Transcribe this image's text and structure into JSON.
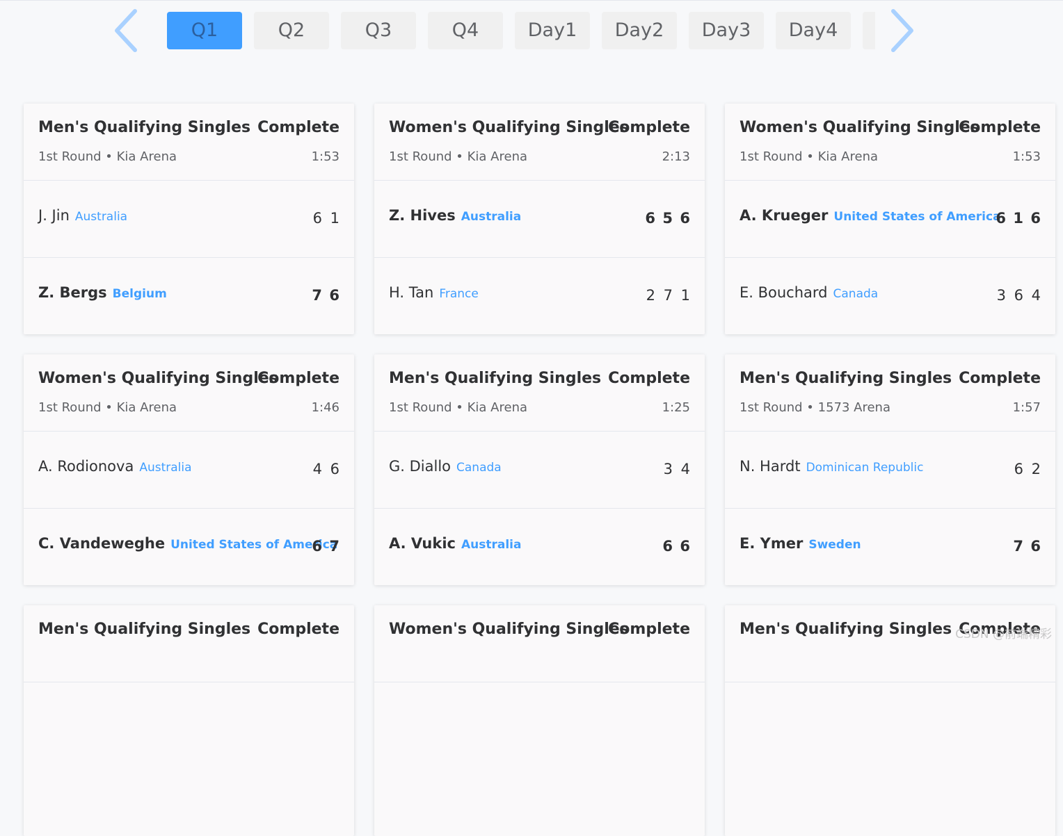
{
  "tabs": [
    "Q1",
    "Q2",
    "Q3",
    "Q4",
    "Day1",
    "Day2",
    "Day3",
    "Day4",
    ""
  ],
  "active_tab": 0,
  "colors": {
    "accent": "#409eff",
    "arrow": "#a9d1ff"
  },
  "matches": [
    {
      "event": "Men's Qualifying Singles",
      "status": "Complete",
      "round": "1st Round • Kia Arena",
      "duration": "1:53",
      "players": [
        {
          "name": "J. Jin",
          "country": "Australia",
          "scores": [
            "6",
            "1"
          ],
          "winner": false
        },
        {
          "name": "Z. Bergs",
          "country": "Belgium",
          "scores": [
            "7",
            "6"
          ],
          "winner": true
        }
      ]
    },
    {
      "event": "Women's Qualifying Singles",
      "status": "Complete",
      "round": "1st Round • Kia Arena",
      "duration": "2:13",
      "players": [
        {
          "name": "Z. Hives",
          "country": "Australia",
          "scores": [
            "6",
            "5",
            "6"
          ],
          "winner": true
        },
        {
          "name": "H. Tan",
          "country": "France",
          "scores": [
            "2",
            "7",
            "1"
          ],
          "winner": false
        }
      ]
    },
    {
      "event": "Women's Qualifying Singles",
      "status": "Complete",
      "round": "1st Round • Kia Arena",
      "duration": "1:53",
      "players": [
        {
          "name": "A. Krueger",
          "country": "United States of America",
          "scores": [
            "6",
            "1",
            "6"
          ],
          "winner": true
        },
        {
          "name": "E. Bouchard",
          "country": "Canada",
          "scores": [
            "3",
            "6",
            "4"
          ],
          "winner": false
        }
      ]
    },
    {
      "event": "Women's Qualifying Singles",
      "status": "Complete",
      "round": "1st Round • Kia Arena",
      "duration": "1:46",
      "players": [
        {
          "name": "A. Rodionova",
          "country": "Australia",
          "scores": [
            "4",
            "6"
          ],
          "winner": false
        },
        {
          "name": "C. Vandeweghe",
          "country": "United States of America",
          "scores": [
            "6",
            "7"
          ],
          "winner": true
        }
      ]
    },
    {
      "event": "Men's Qualifying Singles",
      "status": "Complete",
      "round": "1st Round • Kia Arena",
      "duration": "1:25",
      "players": [
        {
          "name": "G. Diallo",
          "country": "Canada",
          "scores": [
            "3",
            "4"
          ],
          "winner": false
        },
        {
          "name": "A. Vukic",
          "country": "Australia",
          "scores": [
            "6",
            "6"
          ],
          "winner": true
        }
      ]
    },
    {
      "event": "Men's Qualifying Singles",
      "status": "Complete",
      "round": "1st Round • 1573 Arena",
      "duration": "1:57",
      "players": [
        {
          "name": "N. Hardt",
          "country": "Dominican Republic",
          "scores": [
            "6",
            "2"
          ],
          "winner": false
        },
        {
          "name": "E. Ymer",
          "country": "Sweden",
          "scores": [
            "7",
            "6"
          ],
          "winner": true
        }
      ]
    },
    {
      "event": "Men's Qualifying Singles",
      "status": "Complete"
    },
    {
      "event": "Women's Qualifying Singles",
      "status": "Complete"
    },
    {
      "event": "Men's Qualifying Singles",
      "status": "Complete"
    }
  ],
  "watermark": "CSDN @前端精彩"
}
